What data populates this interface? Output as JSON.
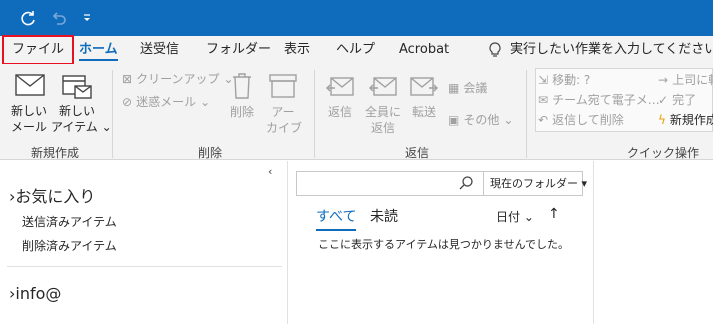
{
  "tabs": {
    "file": "ファイル",
    "home": "ホーム",
    "send_receive": "送受信",
    "folder": "フォルダー",
    "view": "表示",
    "help": "ヘルプ",
    "acrobat": "Acrobat",
    "tell_me": "実行したい作業を入力してください"
  },
  "ribbon": {
    "new_mail": [
      "新しい",
      "メール"
    ],
    "new_items": [
      "新しい",
      "アイテム"
    ],
    "cleanup": "クリーンアップ",
    "junk": "迷惑メール",
    "delete": "削除",
    "archive": [
      "アー",
      "カイブ"
    ],
    "reply": "返信",
    "reply_all": [
      "全員に",
      "返信"
    ],
    "forward": "転送",
    "meeting": "会議",
    "more": "その他",
    "quick_steps": {
      "move": "移動: ?",
      "team_email": "チーム宛て電子メ…",
      "reply_delete": "返信して削除",
      "to_manager": "上司に転",
      "done": "完了",
      "create_new": "新規作成"
    },
    "groups": {
      "new": "新規作成",
      "delete": "削除",
      "respond": "返信",
      "quick_steps": "クイック操作"
    }
  },
  "nav": {
    "favorites": "お気に入り",
    "items": [
      "送信済みアイテム",
      "削除済みアイテム"
    ],
    "account": "info@"
  },
  "message_list": {
    "search_scope": "現在のフォルダー",
    "tab_all": "すべて",
    "tab_unread": "未読",
    "sort_by": "日付",
    "empty": "ここに表示するアイテムは見つかりませんでした。"
  },
  "colors": {
    "accent": "#0f6cbd",
    "highlight_outline": "#e81123"
  }
}
